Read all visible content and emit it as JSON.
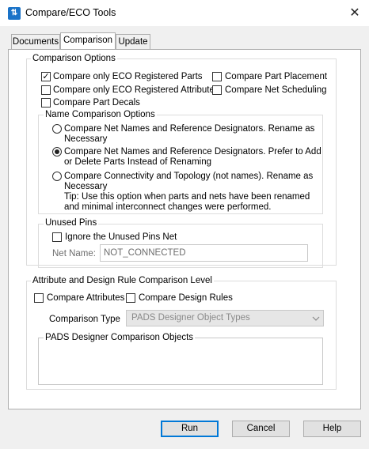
{
  "window": {
    "title": "Compare/ECO Tools",
    "close_glyph": "✕"
  },
  "tabs": [
    {
      "label": "Documents"
    },
    {
      "label": "Comparison"
    },
    {
      "label": "Update"
    }
  ],
  "comparison_options": {
    "legend": "Comparison Options",
    "checkboxes": [
      {
        "label": "Compare only ECO Registered Parts",
        "checked": true
      },
      {
        "label": "Compare Part Placement",
        "checked": false
      },
      {
        "label": "Compare only ECO Registered Attributes",
        "checked": false
      },
      {
        "label": "Compare Net Scheduling",
        "checked": false
      },
      {
        "label": "Compare Part Decals",
        "checked": false
      }
    ],
    "check_glyph": "✓"
  },
  "name_comparison": {
    "legend": "Name Comparison Options",
    "radios": [
      {
        "line1": "Compare Net Names and Reference Designators. Rename as",
        "line2": "Necessary",
        "selected": false
      },
      {
        "line1": "Compare Net Names and Reference Designators. Prefer to Add",
        "line2": "or Delete Parts Instead of Renaming",
        "selected": true
      },
      {
        "line1": "Compare Connectivity and Topology (not names). Rename as",
        "line2": "Necessary",
        "selected": false
      }
    ],
    "tip_line1": "Tip: Use this option when parts and nets have been renamed",
    "tip_line2": "and minimal interconnect changes were performed."
  },
  "unused_pins": {
    "legend": "Unused Pins",
    "ignore_label": "Ignore the Unused Pins Net",
    "ignore_checked": false,
    "net_name_label": "Net Name:",
    "net_name_value": "NOT_CONNECTED"
  },
  "attribute_rules": {
    "legend": "Attribute and Design Rule Comparison Level",
    "compare_attributes_label": "Compare Attributes",
    "compare_design_rules_label": "Compare Design Rules",
    "comparison_type_label": "Comparison Type",
    "comparison_type_value": "PADS Designer Object Types",
    "objects_legend": "PADS Designer Comparison Objects"
  },
  "buttons": {
    "run": "Run",
    "cancel": "Cancel",
    "help": "Help"
  }
}
